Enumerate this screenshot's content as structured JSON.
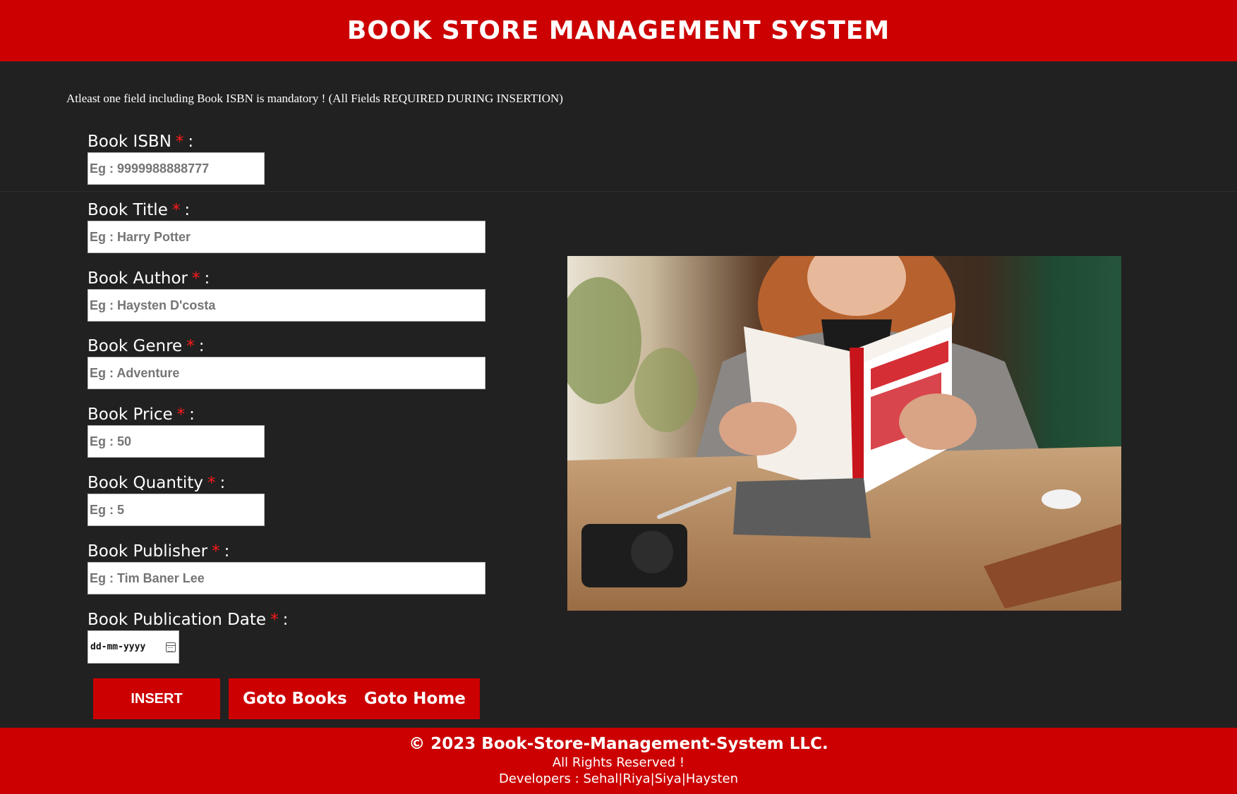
{
  "header": {
    "title": "BOOK STORE MANAGEMENT SYSTEM"
  },
  "notice": "Atleast one field including Book ISBN is mandatory ! (All Fields REQUIRED DURING INSERTION)",
  "form": {
    "required_mark": "*",
    "isbn": {
      "label": "Book ISBN",
      "placeholder": "Eg : 9999988888777"
    },
    "title": {
      "label": "Book Title",
      "placeholder": "Eg : Harry Potter"
    },
    "author": {
      "label": "Book Author",
      "placeholder": "Eg : Haysten D'costa"
    },
    "genre": {
      "label": "Book Genre",
      "placeholder": "Eg : Adventure"
    },
    "price": {
      "label": "Book Price",
      "placeholder": "Eg : 50"
    },
    "quantity": {
      "label": "Book Quantity",
      "placeholder": "Eg : 5"
    },
    "publisher": {
      "label": "Book Publisher",
      "placeholder": "Eg : Tim Baner Lee"
    },
    "pubdate": {
      "label": "Book Publication Date",
      "placeholder": "dd-mm-yyyy"
    }
  },
  "buttons": {
    "insert": "INSERT",
    "goto_books": "Goto Books",
    "goto_home": "Goto Home"
  },
  "footer": {
    "copyright": "© 2023 Book-Store-Management-System LLC.",
    "rights": "All Rights Reserved !",
    "developers": "Developers : Sehal|Riya|Siya|Haysten"
  }
}
